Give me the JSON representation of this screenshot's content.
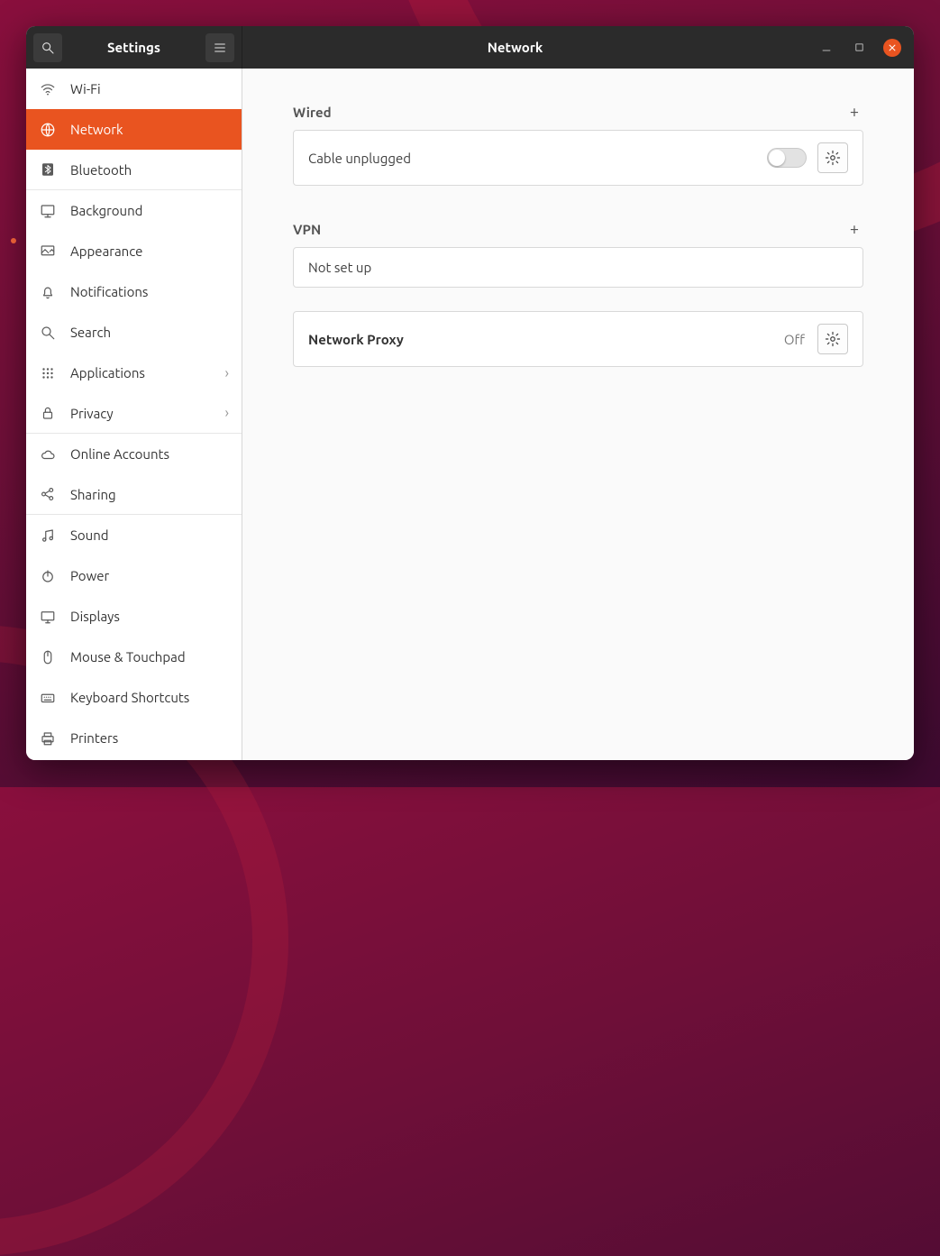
{
  "header": {
    "left_title": "Settings",
    "center_title": "Network"
  },
  "sidebar": {
    "items": [
      {
        "label": "Wi-Fi"
      },
      {
        "label": "Network"
      },
      {
        "label": "Bluetooth"
      },
      {
        "label": "Background"
      },
      {
        "label": "Appearance"
      },
      {
        "label": "Notifications"
      },
      {
        "label": "Search"
      },
      {
        "label": "Applications"
      },
      {
        "label": "Privacy"
      },
      {
        "label": "Online Accounts"
      },
      {
        "label": "Sharing"
      },
      {
        "label": "Sound"
      },
      {
        "label": "Power"
      },
      {
        "label": "Displays"
      },
      {
        "label": "Mouse & Touchpad"
      },
      {
        "label": "Keyboard Shortcuts"
      },
      {
        "label": "Printers"
      }
    ]
  },
  "content": {
    "wired": {
      "title": "Wired",
      "status": "Cable unplugged"
    },
    "vpn": {
      "title": "VPN",
      "status": "Not set up"
    },
    "proxy": {
      "title": "Network Proxy",
      "value": "Off"
    }
  },
  "colors": {
    "accent": "#e95420"
  }
}
